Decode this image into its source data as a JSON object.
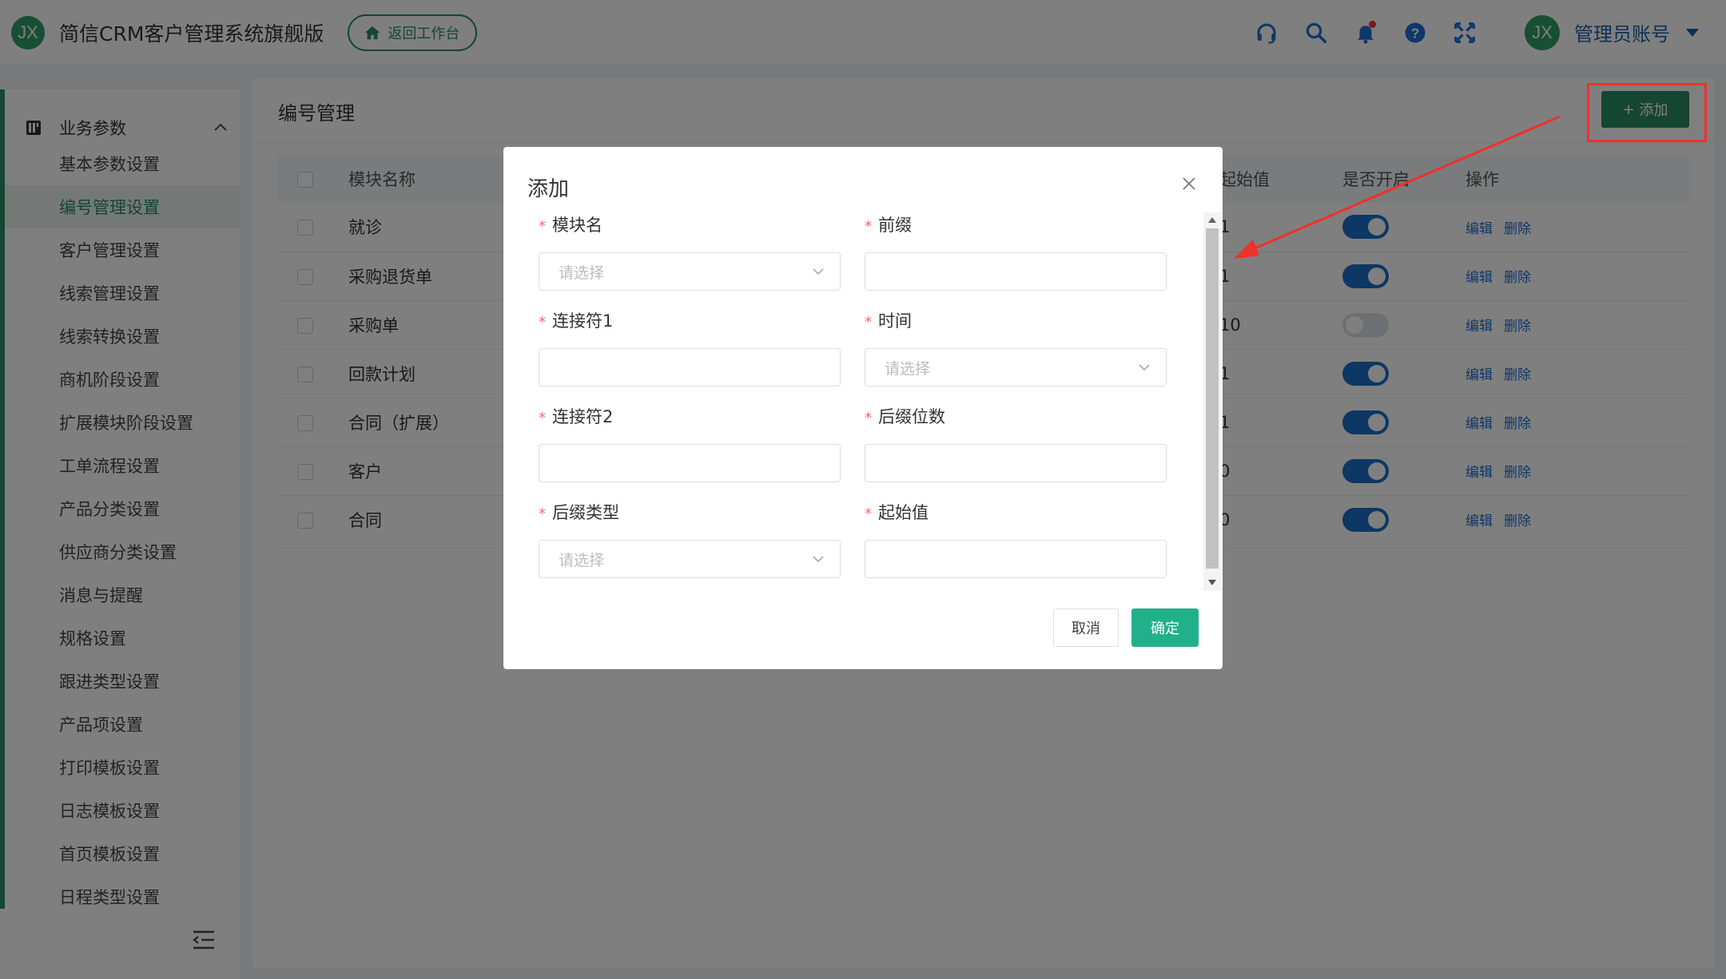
{
  "header": {
    "logo_text": "JX",
    "app_title": "简信CRM客户管理系统旗舰版",
    "back_label": "返回工作台",
    "avatar_text": "JX",
    "user_name": "管理员账号",
    "icons": [
      "headset-icon",
      "search-icon",
      "bell-icon",
      "help-icon",
      "fullscreen-icon"
    ]
  },
  "sidebar": {
    "group_label": "业务参数",
    "items": [
      {
        "label": "基本参数设置",
        "active": false
      },
      {
        "label": "编号管理设置",
        "active": true
      },
      {
        "label": "客户管理设置",
        "active": false
      },
      {
        "label": "线索管理设置",
        "active": false
      },
      {
        "label": "线索转换设置",
        "active": false
      },
      {
        "label": "商机阶段设置",
        "active": false
      },
      {
        "label": "扩展模块阶段设置",
        "active": false
      },
      {
        "label": "工单流程设置",
        "active": false
      },
      {
        "label": "产品分类设置",
        "active": false
      },
      {
        "label": "供应商分类设置",
        "active": false
      },
      {
        "label": "消息与提醒",
        "active": false
      },
      {
        "label": "规格设置",
        "active": false
      },
      {
        "label": "跟进类型设置",
        "active": false
      },
      {
        "label": "产品项设置",
        "active": false
      },
      {
        "label": "打印模板设置",
        "active": false
      },
      {
        "label": "日志模板设置",
        "active": false
      },
      {
        "label": "首页模板设置",
        "active": false
      },
      {
        "label": "日程类型设置",
        "active": false
      }
    ]
  },
  "main": {
    "title": "编号管理",
    "add_label": "添加",
    "table": {
      "columns": [
        "模块名称",
        "起始值",
        "是否开启",
        "操作"
      ],
      "rows": [
        {
          "name": "就诊",
          "start": "1",
          "enabled": true
        },
        {
          "name": "采购退货单",
          "start": "1",
          "enabled": true
        },
        {
          "name": "采购单",
          "start": "10",
          "enabled": false
        },
        {
          "name": "回款计划",
          "start": "1",
          "enabled": true
        },
        {
          "name": "合同（扩展）",
          "start": "1",
          "enabled": true
        },
        {
          "name": "客户",
          "start": "0",
          "enabled": true
        },
        {
          "name": "合同",
          "start": "0",
          "enabled": true
        }
      ],
      "edit_label": "编辑",
      "delete_label": "删除"
    }
  },
  "dialog": {
    "title": "添加",
    "fields": {
      "module_name": {
        "label": "模块名",
        "placeholder": "请选择"
      },
      "prefix": {
        "label": "前缀",
        "placeholder": ""
      },
      "connector1": {
        "label": "连接符1",
        "placeholder": ""
      },
      "time": {
        "label": "时间",
        "placeholder": "请选择"
      },
      "connector2": {
        "label": "连接符2",
        "placeholder": ""
      },
      "suffix_digits": {
        "label": "后缀位数",
        "placeholder": ""
      },
      "suffix_type": {
        "label": "后缀类型",
        "placeholder": "请选择"
      },
      "start_value": {
        "label": "起始值",
        "placeholder": ""
      }
    },
    "required_mark": "*",
    "cancel_label": "取消",
    "ok_label": "确定"
  },
  "colors": {
    "brand": "#2a8a66",
    "toggle_on": "#1b6fc8",
    "link": "#1e6ed0",
    "ok_button": "#22b08a",
    "annotation": "#f0302a"
  }
}
